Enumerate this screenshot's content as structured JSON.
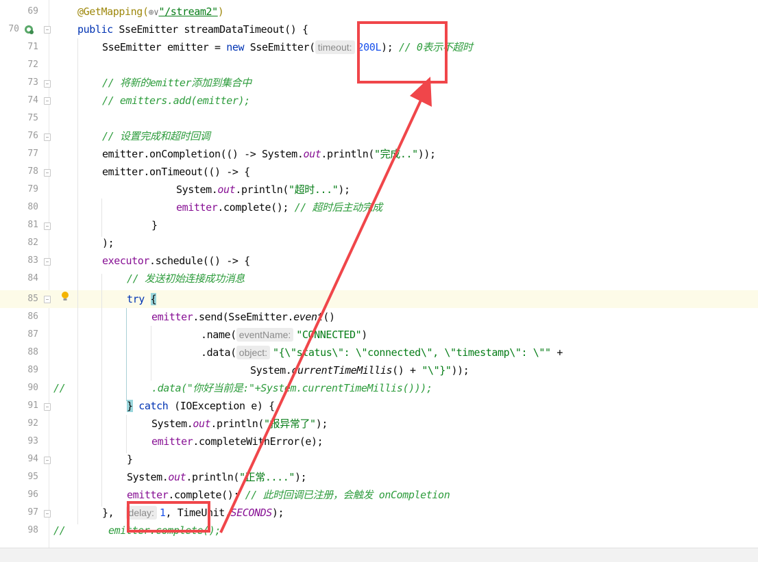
{
  "lines": [
    {
      "n": "69",
      "text": "@GetMapping(⊕∨\"/stream2\")"
    },
    {
      "n": "70",
      "text": "public SseEmitter streamDataTimeout() {"
    },
    {
      "n": "71",
      "text": "SseEmitter emitter = new SseEmitter( timeout: 200L); // 0表示不超时"
    },
    {
      "n": "72",
      "text": ""
    },
    {
      "n": "73",
      "text": "// 将新的emitter添加到集合中"
    },
    {
      "n": "74",
      "text": "// emitters.add(emitter);"
    },
    {
      "n": "75",
      "text": ""
    },
    {
      "n": "76",
      "text": "// 设置完成和超时回调"
    },
    {
      "n": "77",
      "text": "emitter.onCompletion(() -> System.out.println(\"完成..\"));"
    },
    {
      "n": "78",
      "text": "emitter.onTimeout(() -> {"
    },
    {
      "n": "79",
      "text": "System.out.println(\"超时...\");"
    },
    {
      "n": "80",
      "text": "emitter.complete(); // 超时后主动完成"
    },
    {
      "n": "81",
      "text": "}"
    },
    {
      "n": "82",
      "text": ");"
    },
    {
      "n": "83",
      "text": "executor.schedule(() -> {"
    },
    {
      "n": "84",
      "text": "// 发送初始连接成功消息"
    },
    {
      "n": "85",
      "text": "try {"
    },
    {
      "n": "86",
      "text": "emitter.send(SseEmitter.event()"
    },
    {
      "n": "87",
      "text": ".name( eventName: \"CONNECTED\")"
    },
    {
      "n": "88",
      "text": ".data( object: \"{\\\"status\\\": \\\"connected\\\", \\\"timestamp\\\": \\\"\" +"
    },
    {
      "n": "89",
      "text": "System.currentTimeMillis() + \"\\\"}\"));"
    },
    {
      "n": "90",
      "text": "//              .data(\"你好当前是:\"+System.currentTimeMillis()));"
    },
    {
      "n": "91",
      "text": "} catch (IOException e) {"
    },
    {
      "n": "92",
      "text": "System.out.println(\"报异常了\");"
    },
    {
      "n": "93",
      "text": "emitter.completeWithError(e);"
    },
    {
      "n": "94",
      "text": "}"
    },
    {
      "n": "95",
      "text": "System.out.println(\"正常....\");"
    },
    {
      "n": "96",
      "text": "emitter.complete(); // 此时回调已注册，会触发 onCompletion"
    },
    {
      "n": "97",
      "text": "},  delay: 1, TimeUnit.SECONDS);"
    },
    {
      "n": "98",
      "text": "//       emitter.complete();"
    }
  ],
  "tokens": {
    "l69_ann": "@GetMapping(",
    "l69_globe": "⊕∨",
    "l69_str": "\"/stream2\"",
    "l69_close": ")",
    "l70_kw": "public",
    "l70_rest": " SseEmitter streamDataTimeout() {",
    "l71_a": "SseEmitter emitter = ",
    "l71_new": "new",
    "l71_b": " SseEmitter(",
    "l71_hint": "timeout:",
    "l71_num": "200L",
    "l71_c": "); ",
    "l71_cm": "// 0表示不超时",
    "l73": "// 将新的emitter添加到集合中",
    "l74": "// emitters.add(emitter);",
    "l76": "// 设置完成和超时回调",
    "l77_a": "emitter.onCompletion(() -> System.",
    "l77_out": "out",
    "l77_b": ".println(",
    "l77_str": "\"完成..\"",
    "l77_c": "));",
    "l78": "emitter.onTimeout(() -> {",
    "l79_a": "System.",
    "l79_out": "out",
    "l79_b": ".println(",
    "l79_str": "\"超时...\"",
    "l79_c": ");",
    "l80_fld": "emitter",
    "l80_a": ".complete(); ",
    "l80_cm": "// 超时后主动完成",
    "l81": "}",
    "l82": ");",
    "l83_fld": "executor",
    "l83_a": ".schedule(() -> {",
    "l84": "// 发送初始连接成功消息",
    "l85_kw": "try",
    "l85_brace": "{",
    "l86_fld": "emitter",
    "l86_a": ".send(SseEmitter.",
    "l86_ev": "event",
    "l86_b": "()",
    "l87_a": ".name(",
    "l87_hint": "eventName:",
    "l87_str": "\"CONNECTED\"",
    "l87_b": ")",
    "l88_a": ".data(",
    "l88_hint": "object:",
    "l88_str": "\"{\\\"status\\\": \\\"connected\\\", \\\"timestamp\\\": \\\"\"",
    "l88_b": " +",
    "l89_a": "System.",
    "l89_it": "currentTimeMillis",
    "l89_b": "() + ",
    "l89_str": "\"\\\"}\"",
    "l89_c": "));",
    "l90_slash": "//",
    "l90_cm": ".data(\"你好当前是:\"+System.currentTimeMillis()));",
    "l91_brace": "}",
    "l91_kw": "catch",
    "l91_a": " (IOException e) {",
    "l92_a": "System.",
    "l92_out": "out",
    "l92_b": ".println(",
    "l92_str": "\"报异常了\"",
    "l92_c": ");",
    "l93_fld": "emitter",
    "l93_a": ".completeWithError(e);",
    "l94": "}",
    "l95_a": "System.",
    "l95_out": "out",
    "l95_b": ".println(",
    "l95_str": "\"正常....\"",
    "l95_c": ");",
    "l96_fld": "emitter",
    "l96_a": ".complete(); ",
    "l96_cm": "// 此时回调已注册，会触发 onCompletion",
    "l97_a": "},",
    "l97_hint": "delay:",
    "l97_num": "1",
    "l97_b": ", TimeUnit.",
    "l97_st": "SECONDS",
    "l97_c": ");",
    "l98_slash": "//",
    "l98_cm": "emitter.complete();"
  }
}
